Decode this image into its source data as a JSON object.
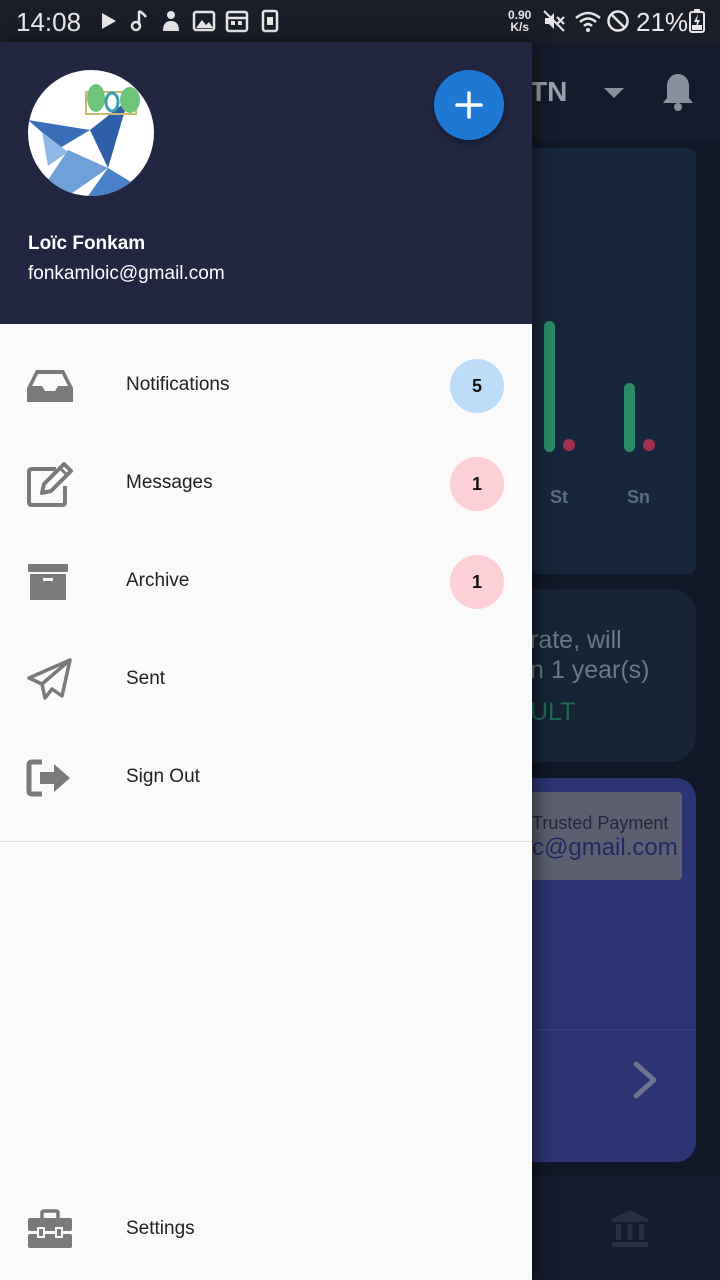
{
  "status_bar": {
    "time": "14:08",
    "speed_value": "0.90",
    "speed_unit": "K/s",
    "battery_percent": "21%",
    "icons": [
      "play-icon",
      "music-note-icon",
      "app-icon",
      "image-icon",
      "calendar-icon",
      "sim-icon",
      "mute-icon",
      "wifi-icon",
      "do-not-disturb-icon",
      "battery-charging-icon"
    ]
  },
  "app": {
    "currency_label": "TN",
    "chart_days": [
      "St",
      "Sn"
    ],
    "loan_line1": "rate, will",
    "loan_line2": "n 1 year(s)",
    "loan_result": "ULT",
    "payment_title": "Trusted Payment",
    "payment_email": "c@gmail.com",
    "colors": {
      "chart_bar": "#2b8a68",
      "chart_dot": "#a32d4c",
      "payment_card": "#2c3474"
    }
  },
  "drawer": {
    "user": {
      "name": "Loïc Fonkam",
      "email": "fonkamloic@gmail.com"
    },
    "items": [
      {
        "label": "Notifications",
        "icon": "inbox-icon",
        "badge": "5",
        "badge_color": "#bcdcf7"
      },
      {
        "label": "Messages",
        "icon": "edit-icon",
        "badge": "1",
        "badge_color": "#fdcfd6"
      },
      {
        "label": "Archive",
        "icon": "archive-icon",
        "badge": "1",
        "badge_color": "#fdcfd6"
      },
      {
        "label": "Sent",
        "icon": "send-icon",
        "badge": "",
        "badge_color": ""
      },
      {
        "label": "Sign Out",
        "icon": "sign-out-icon",
        "badge": "",
        "badge_color": ""
      }
    ],
    "settings_label": "Settings",
    "colors": {
      "header": "#222641",
      "add_button": "#1e78d4"
    }
  }
}
